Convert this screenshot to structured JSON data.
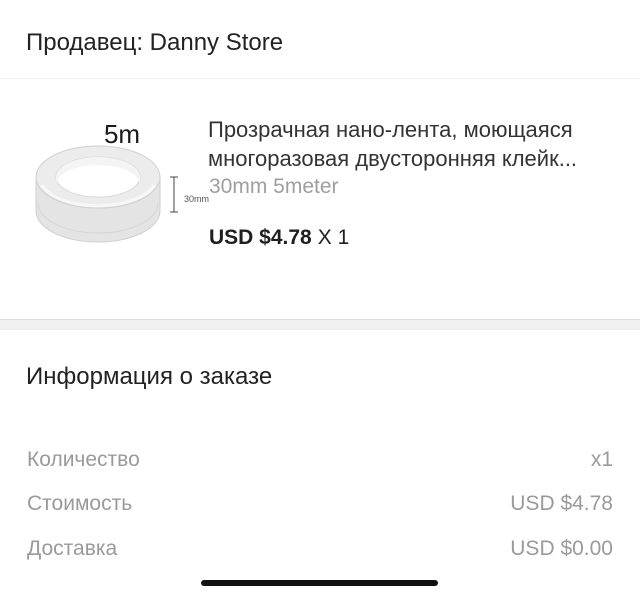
{
  "seller": {
    "label": "Продавец: Danny Store"
  },
  "product": {
    "image_caption": "5m",
    "image_dimension_label": "30mm",
    "title_line1": "Прозрачная нано-лента, моющаяся",
    "title_line2": "многоразовая двусторонняя клейк...",
    "variant": "30mm 5meter",
    "price": "USD $4.78",
    "quantity": "X 1"
  },
  "order_info": {
    "title": "Информация о заказе",
    "rows": [
      {
        "label": "Количество",
        "value": "x1"
      },
      {
        "label": "Стоимость",
        "value": "USD $4.78"
      },
      {
        "label": "Доставка",
        "value": "USD $0.00"
      }
    ]
  },
  "colors": {
    "text_primary": "#222222",
    "text_secondary": "#9a9a9a",
    "divider": "#f0f0f0",
    "home_indicator": "#111111"
  }
}
